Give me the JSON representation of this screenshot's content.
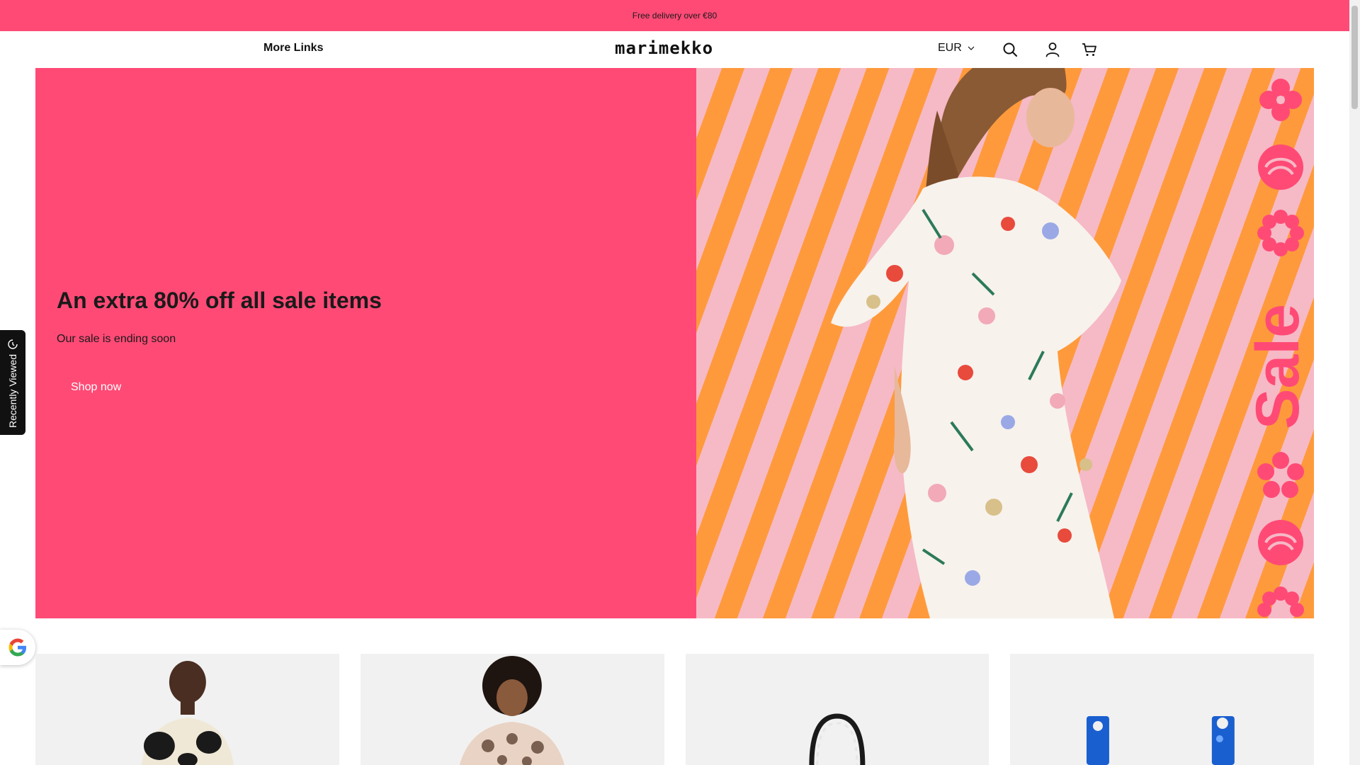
{
  "announcement": {
    "text": "Free delivery over €80"
  },
  "header": {
    "more_links": "More Links",
    "logo": "marimekko",
    "currency": "EUR",
    "icons": [
      "search-icon",
      "account-icon",
      "cart-icon"
    ]
  },
  "hero": {
    "title": "An extra 80% off all sale items",
    "subtitle": "Our sale is ending soon",
    "cta": "Shop now",
    "image_text": "Sale",
    "colors": {
      "accent": "#ff4a76",
      "stripe_orange": "#ff9a3c",
      "stripe_pink": "#f6b9c6"
    }
  },
  "recently_viewed": {
    "label": "Recently Viewed"
  },
  "products": [
    {
      "image": "model-black-white-poppy-dress"
    },
    {
      "image": "model-beige-unikko-dress"
    },
    {
      "image": "black-white-tote-bag"
    },
    {
      "image": "blue-unikko-bag"
    }
  ]
}
